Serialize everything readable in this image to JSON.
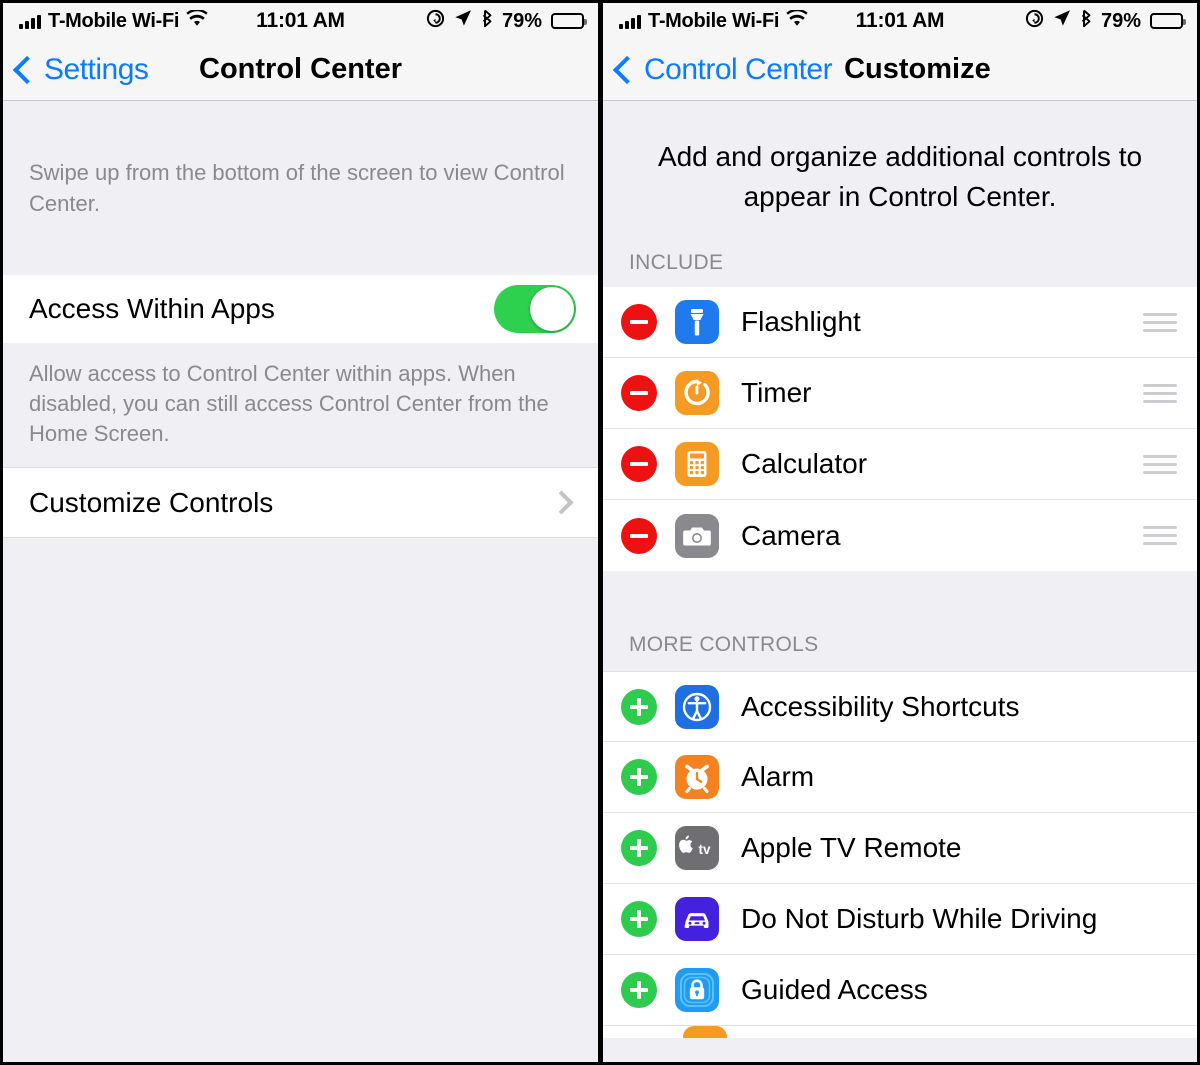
{
  "status_bar": {
    "carrier": "T-Mobile Wi-Fi",
    "time": "11:01 AM",
    "battery_percent": "79%",
    "icons": [
      "signal-bars-icon",
      "wifi-icon",
      "orientation-lock-icon",
      "location-arrow-icon",
      "bluetooth-icon",
      "battery-icon"
    ]
  },
  "left_screen": {
    "nav": {
      "back_label": "Settings",
      "title": "Control Center"
    },
    "intro_text": "Swipe up from the bottom of the screen to view Control Center.",
    "access_row": {
      "label": "Access Within Apps",
      "toggle_state": "on"
    },
    "footer_text": "Allow access to Control Center within apps. When disabled, you can still access Control Center from the Home Screen.",
    "customize_row": {
      "label": "Customize Controls"
    }
  },
  "right_screen": {
    "nav": {
      "back_label": "Control Center",
      "title": "Customize"
    },
    "description": "Add and organize additional controls to appear in Control Center.",
    "include_section": {
      "label": "INCLUDE",
      "items": [
        {
          "label": "Flashlight",
          "icon": "flashlight-icon",
          "icon_color": "#1f7bed",
          "action": "remove"
        },
        {
          "label": "Timer",
          "icon": "timer-icon",
          "icon_color": "#f59a23",
          "action": "remove"
        },
        {
          "label": "Calculator",
          "icon": "calculator-icon",
          "icon_color": "#f59a23",
          "action": "remove"
        },
        {
          "label": "Camera",
          "icon": "camera-icon",
          "icon_color": "#8a8a8e",
          "action": "remove"
        }
      ]
    },
    "more_controls_section": {
      "label": "MORE CONTROLS",
      "items": [
        {
          "label": "Accessibility Shortcuts",
          "icon": "accessibility-icon",
          "icon_color": "#1f6fe0",
          "action": "add"
        },
        {
          "label": "Alarm",
          "icon": "alarm-clock-icon",
          "icon_color": "#f58220",
          "action": "add"
        },
        {
          "label": "Apple TV Remote",
          "icon": "apple-tv-icon",
          "icon_color": "#6e6e73",
          "action": "add"
        },
        {
          "label": "Do Not Disturb While Driving",
          "icon": "car-icon",
          "icon_color": "#4422dd",
          "action": "add"
        },
        {
          "label": "Guided Access",
          "icon": "lock-icon",
          "icon_color": "#1f9bf0",
          "action": "add"
        }
      ]
    }
  },
  "colors": {
    "accent_blue": "#0a7cff",
    "toggle_green": "#2ed14e",
    "remove_red": "#ee1111",
    "add_green": "#2ecb4f",
    "group_background": "#efeff4",
    "secondary_text": "#8a8a8e"
  }
}
